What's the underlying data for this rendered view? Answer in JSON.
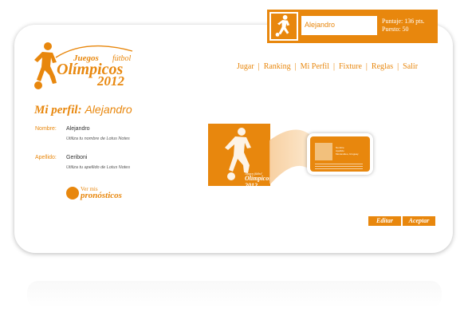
{
  "user_bar": {
    "username": "Alejandro",
    "puntaje": "Puntaje: 136 pts.",
    "puesto": "Puesto: 50"
  },
  "logo": {
    "juegos": "Juegos",
    "futbol": "fútbol",
    "olimpicos": "Olímpicos",
    "year": "2012"
  },
  "nav": {
    "items": [
      "Jugar",
      "Ranking",
      "Mi Perfil",
      "Fixture",
      "Reglas",
      "Salir"
    ],
    "separator": "|"
  },
  "profile": {
    "title": "Mi perfil:",
    "name": "Alejandro",
    "fields": [
      {
        "label": "Nombre:",
        "value": "Alejandro",
        "hint": "Utiliza tu nombre de Lotus Notes"
      },
      {
        "label": "Apellido:",
        "value": "Geriboni",
        "hint": "Utiliza tu apellido de Lotus Notes"
      }
    ]
  },
  "pronosticos_link": {
    "line1": "Ver mis",
    "line2": "pronósticos"
  },
  "illustration": {
    "big_caption_small": "Juegos fútbol",
    "big_caption_big": "Olímpicos 2012",
    "mini_card_lines": [
      "Nombre",
      "Apellido",
      "Montevideo, Uruguay"
    ]
  },
  "actions": {
    "edit": "Editar",
    "accept": "Aceptar"
  },
  "colors": {
    "accent": "#e8870d",
    "text": "#333333"
  }
}
